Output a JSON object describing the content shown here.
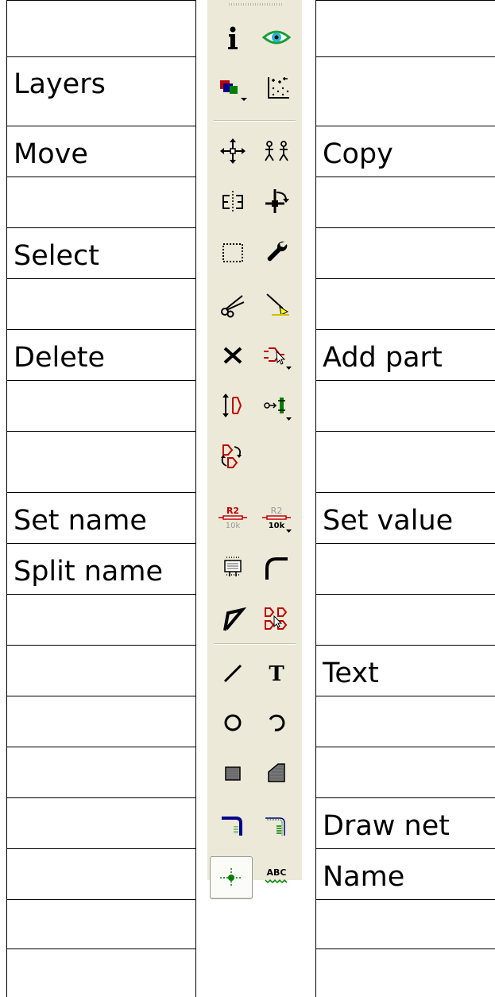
{
  "labels": {
    "layers": "Layers",
    "move": "Move",
    "copy": "Copy",
    "select": "Select",
    "delete": "Delete",
    "add_part": "Add part",
    "set_name": "Set name",
    "set_value": "Set value",
    "split_name": "Split name",
    "text": "Text",
    "draw_net": "Draw net",
    "name": "Name"
  },
  "toolbar_icons": {
    "row1": [
      "info-icon",
      "eye-icon"
    ],
    "row2": [
      "layers-icon",
      "grid-icon"
    ],
    "row3": [
      "move-icon",
      "copy-icon"
    ],
    "row4": [
      "mirror-icon",
      "rotate-icon"
    ],
    "row5": [
      "select-icon",
      "wrench-icon"
    ],
    "row6": [
      "cut-icon",
      "paste-icon"
    ],
    "row7": [
      "delete-icon",
      "add-part-icon"
    ],
    "row8": [
      "pinswap-icon",
      "replace-icon"
    ],
    "row9": [
      "gateswap-icon"
    ],
    "row10": [
      "set-name-icon",
      "set-value-icon"
    ],
    "row11": [
      "split-name-icon",
      "miter-icon"
    ],
    "row12": [
      "split-icon",
      "invoke-icon"
    ],
    "row13": [
      "wire-icon",
      "text-icon"
    ],
    "row14": [
      "circle-icon",
      "arc-icon"
    ],
    "row15": [
      "rect-icon",
      "polygon-icon"
    ],
    "row16": [
      "bus-icon",
      "net-icon"
    ],
    "row17": [
      "junction-icon",
      "label-icon"
    ]
  },
  "icon_glyphs": {
    "text": "T",
    "abc": "ABC",
    "r2": "R2",
    "tenk": "10k"
  },
  "colors": {
    "toolbar_bg": "#ece9d8",
    "net_blue": "#00008b",
    "net_green": "#008000",
    "eye_green": "#1a9e3a",
    "eye_cyan": "#2ab4d6",
    "highlight_yellow": "#ffff00",
    "part_red": "#c00000"
  }
}
